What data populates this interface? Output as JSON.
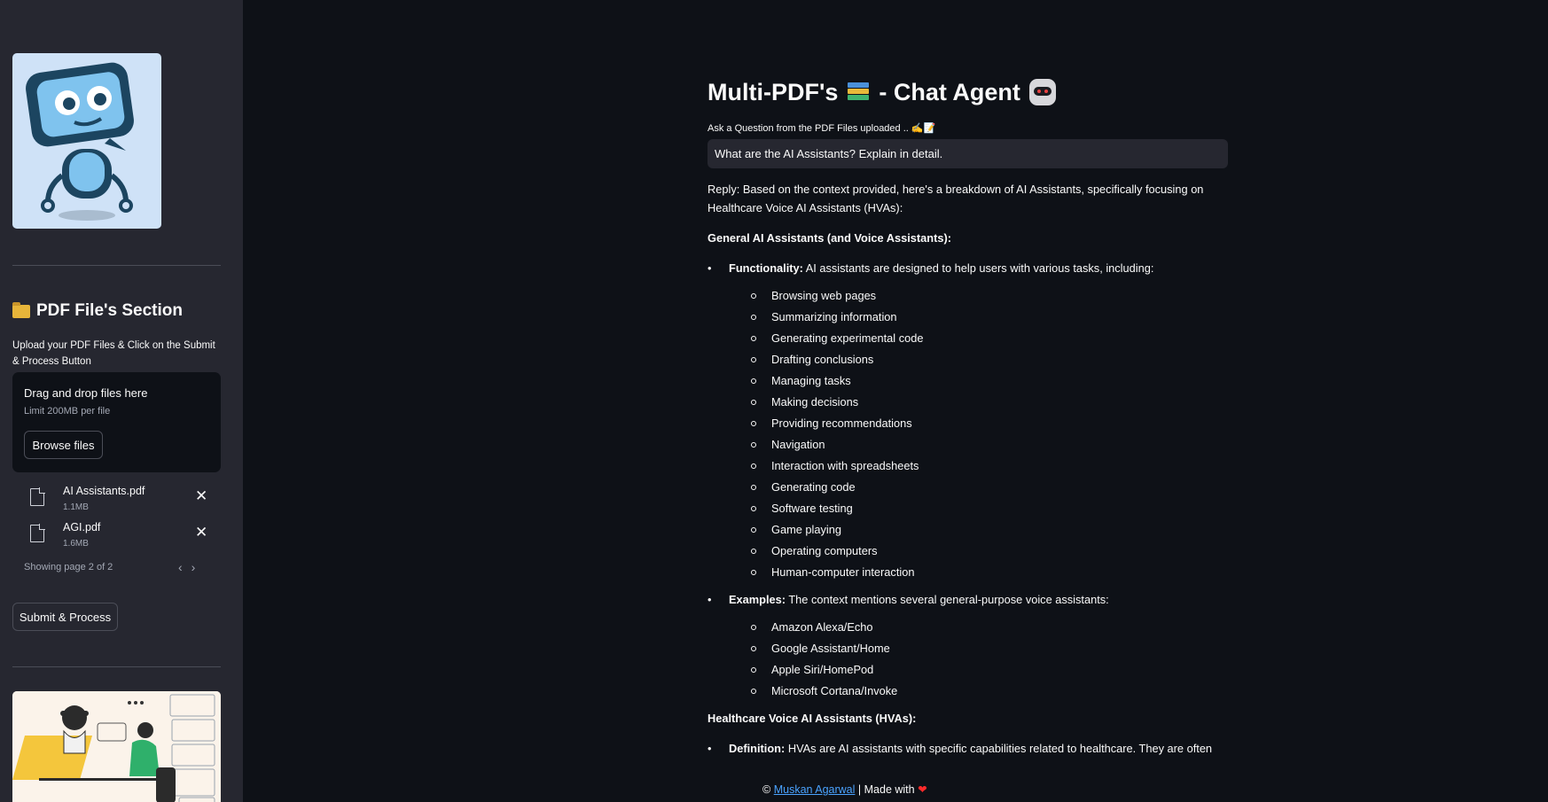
{
  "main": {
    "title_before": "Multi-PDF's",
    "title_after": "- Chat Agent",
    "ask_label": "Ask a Question from the PDF Files uploaded .. ✍️📝",
    "question_value": "What are the AI Assistants? Explain in detail.",
    "reply_intro": "Reply: Based on the context provided, here's a breakdown of AI Assistants, specifically focusing on Healthcare Voice AI Assistants (HVAs):",
    "general_heading": "General AI Assistants (and Voice Assistants):",
    "functionality_label": "Functionality:",
    "functionality_text": " AI assistants are designed to help users with various tasks, including:",
    "functionality_items": [
      "Browsing web pages",
      "Summarizing information",
      "Generating experimental code",
      "Drafting conclusions",
      "Managing tasks",
      "Making decisions",
      "Providing recommendations",
      "Navigation",
      "Interaction with spreadsheets",
      "Generating code",
      "Software testing",
      "Game playing",
      "Operating computers",
      "Human-computer interaction"
    ],
    "examples_label": "Examples:",
    "examples_text": " The context mentions several general-purpose voice assistants:",
    "examples_items": [
      "Amazon Alexa/Echo",
      "Google Assistant/Home",
      "Apple Siri/HomePod",
      "Microsoft Cortana/Invoke"
    ],
    "hva_heading": "Healthcare Voice AI Assistants (HVAs):",
    "definition_label": "Definition:",
    "definition_text": " HVAs are AI assistants with specific capabilities related to healthcare. They are often"
  },
  "sidebar": {
    "section_title": "PDF File's Section",
    "upload_help": "Upload your PDF Files & Click on the Submit & Process Button",
    "dropzone_title": "Drag and drop files here",
    "dropzone_limit": "Limit 200MB per file",
    "browse_label": "Browse files",
    "files": [
      {
        "name": "AI Assistants.pdf",
        "size": "1.1MB"
      },
      {
        "name": "AGI.pdf",
        "size": "1.6MB"
      }
    ],
    "pager_text": "Showing page 2 of 2",
    "submit_label": "Submit & Process"
  },
  "footer": {
    "copyright": "©",
    "author": "Muskan Agarwal",
    "made_with": "| Made with"
  },
  "colors": {
    "background": "#0e1117",
    "sidebar": "#262730",
    "link": "#4aa3ff",
    "heart": "#ff2b2b"
  }
}
